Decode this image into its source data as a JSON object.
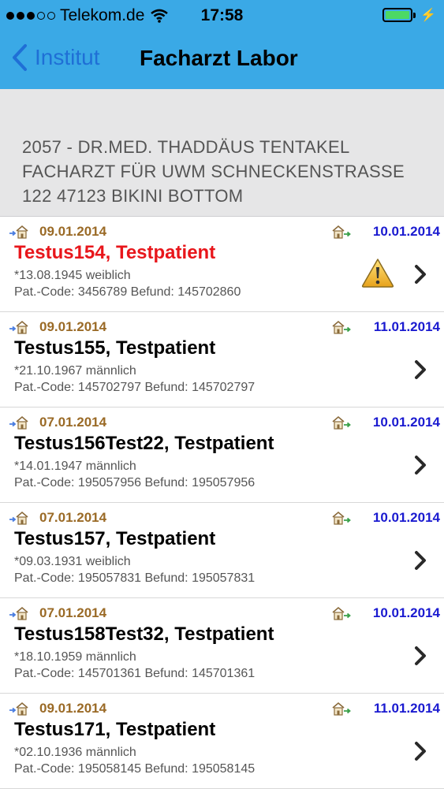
{
  "status": {
    "carrier": "Telekom.de",
    "time": "17:58"
  },
  "nav": {
    "back_label": "Institut",
    "title": "Facharzt Labor"
  },
  "institute": {
    "address": "2057 - DR.MED. THADDÄUS TENTAKEL FACHARZT FÜR UWM SCHNECKENSTRASSE 122   47123 BIKINI BOTTOM"
  },
  "patients": [
    {
      "date_in": "09.01.2014",
      "date_out": "10.01.2014",
      "name": "Testus154, Testpatient",
      "birth": "*13.08.1945 weiblich",
      "codes": "Pat.-Code: 3456789 Befund: 145702860",
      "alert": true
    },
    {
      "date_in": "09.01.2014",
      "date_out": "11.01.2014",
      "name": "Testus155, Testpatient",
      "birth": "*21.10.1967 männlich",
      "codes": "Pat.-Code: 145702797 Befund: 145702797",
      "alert": false
    },
    {
      "date_in": "07.01.2014",
      "date_out": "10.01.2014",
      "name": "Testus156Test22, Testpatient",
      "birth": "*14.01.1947 männlich",
      "codes": "Pat.-Code: 195057956 Befund: 195057956",
      "alert": false
    },
    {
      "date_in": "07.01.2014",
      "date_out": "10.01.2014",
      "name": "Testus157, Testpatient",
      "birth": "*09.03.1931 weiblich",
      "codes": "Pat.-Code: 195057831 Befund: 195057831",
      "alert": false
    },
    {
      "date_in": "07.01.2014",
      "date_out": "10.01.2014",
      "name": "Testus158Test32, Testpatient",
      "birth": "*18.10.1959 männlich",
      "codes": "Pat.-Code: 145701361 Befund: 145701361",
      "alert": false
    },
    {
      "date_in": "09.01.2014",
      "date_out": "11.01.2014",
      "name": "Testus171, Testpatient",
      "birth": "*02.10.1936 männlich",
      "codes": "Pat.-Code: 195058145 Befund: 195058145",
      "alert": false
    }
  ],
  "icons": {
    "row_left": "house-arrow-in-icon",
    "row_right": "house-arrow-out-icon",
    "warning": "warning-icon",
    "disclosure": "chevron-right-icon"
  },
  "colors": {
    "nav_bar": "#3aa9e6",
    "back": "#1f6fd6",
    "alert_name": "#e8161b",
    "date_in": "#9a6a26",
    "date_out": "#1a1ad0",
    "battery": "#4cd964"
  }
}
